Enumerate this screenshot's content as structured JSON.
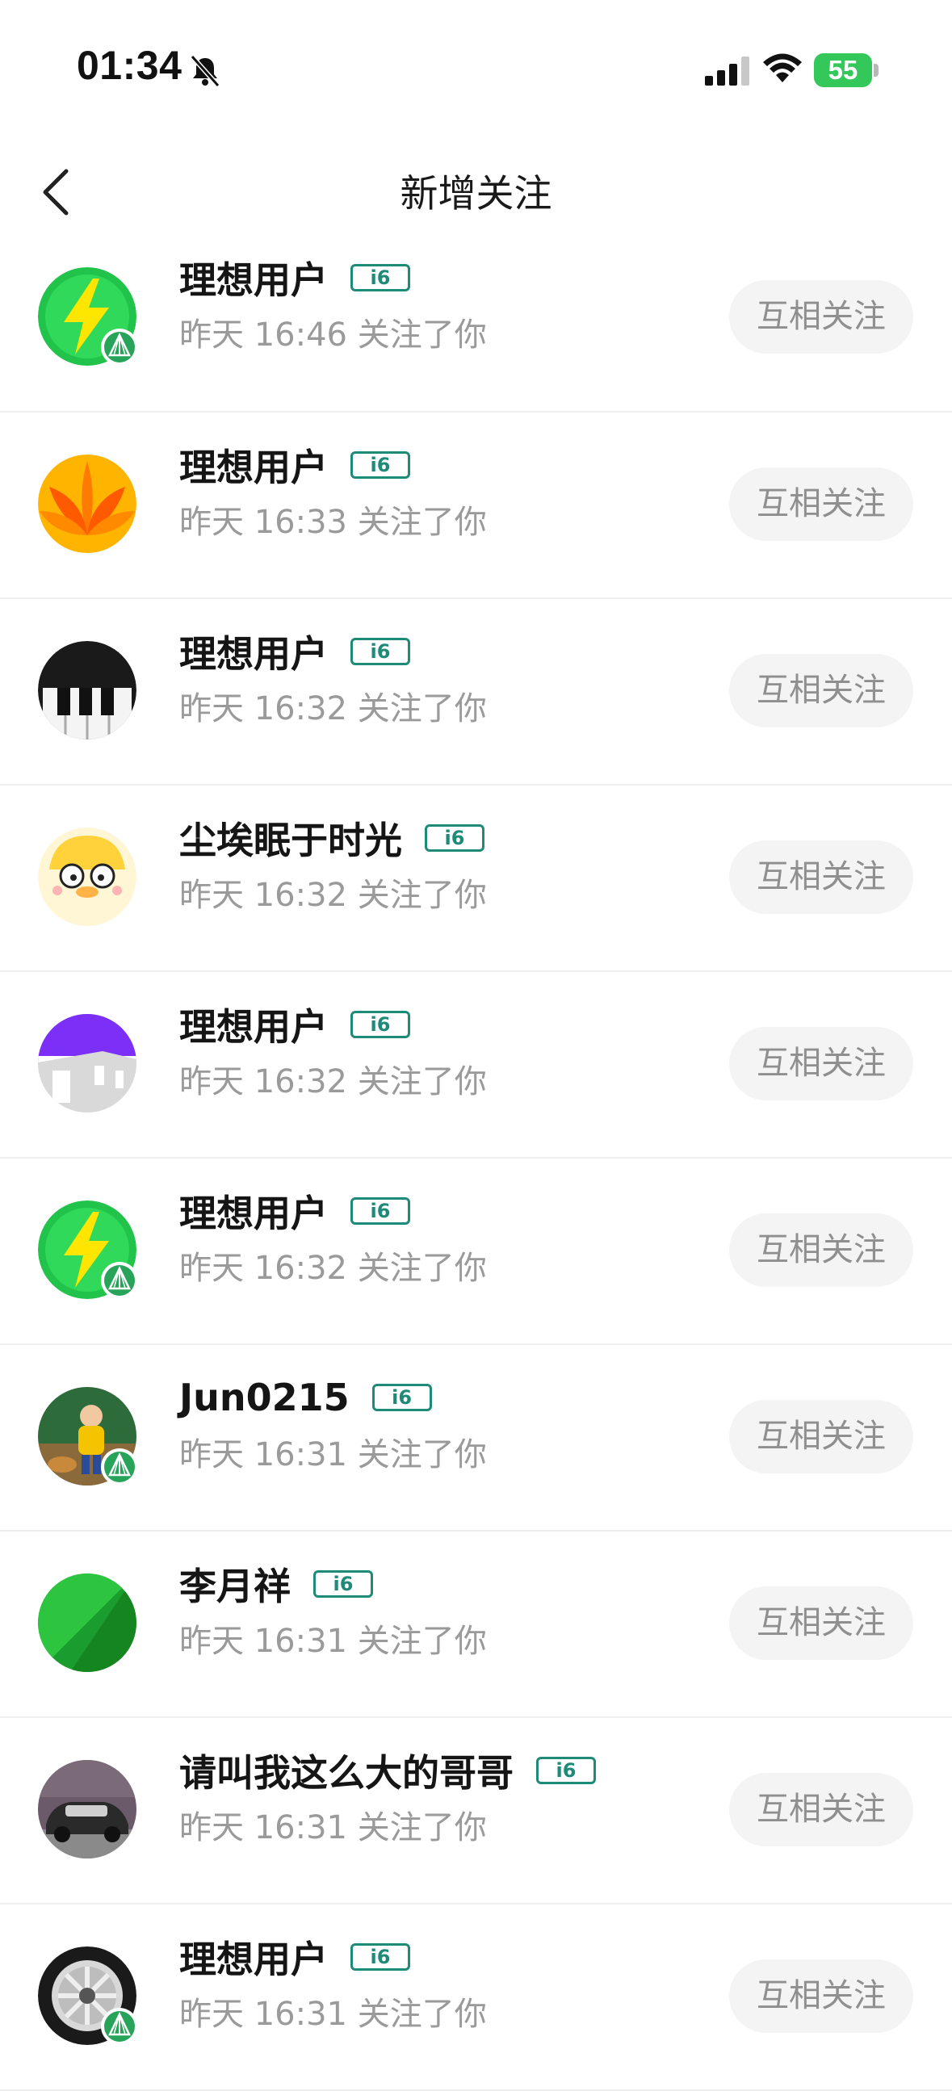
{
  "status_bar": {
    "time": "01:34",
    "battery": "55"
  },
  "header": {
    "title": "新增关注"
  },
  "colors": {
    "tag_border": "#1f8a77",
    "battery": "#34c759",
    "secondary_text": "#9a9a9a",
    "button_bg": "#f4f4f4"
  },
  "followers": [
    {
      "name": "理想用户",
      "tag": "i6",
      "time_text": "昨天 16:46 关注了你",
      "button": "互相关注",
      "avatar": "lightning-green-avatar"
    },
    {
      "name": "理想用户",
      "tag": "i6",
      "time_text": "昨天 16:33 关注了你",
      "button": "互相关注",
      "avatar": "orange-flower-avatar"
    },
    {
      "name": "理想用户",
      "tag": "i6",
      "time_text": "昨天 16:32 关注了你",
      "button": "互相关注",
      "avatar": "piano-keys-avatar"
    },
    {
      "name": "尘埃眠于时光",
      "tag": "i6",
      "time_text": "昨天 16:32 关注了你",
      "button": "互相关注",
      "avatar": "cartoon-duck-avatar"
    },
    {
      "name": "理想用户",
      "tag": "i6",
      "time_text": "昨天 16:32 关注了你",
      "button": "互相关注",
      "avatar": "purple-building-avatar"
    },
    {
      "name": "理想用户",
      "tag": "i6",
      "time_text": "昨天 16:32 关注了你",
      "button": "互相关注",
      "avatar": "lightning-green-avatar"
    },
    {
      "name": "Jun0215",
      "tag": "i6",
      "time_text": "昨天 16:31 关注了你",
      "button": "互相关注",
      "avatar": "child-photo-avatar"
    },
    {
      "name": "李月祥",
      "tag": "i6",
      "time_text": "昨天 16:31 关注了你",
      "button": "互相关注",
      "avatar": "green-geometric-avatar"
    },
    {
      "name": "请叫我这么大的哥哥",
      "tag": "i6",
      "time_text": "昨天 16:31 关注了你",
      "button": "互相关注",
      "avatar": "car-photo-avatar"
    },
    {
      "name": "理想用户",
      "tag": "i6",
      "time_text": "昨天 16:31 关注了你",
      "button": "互相关注",
      "avatar": "wheel-avatar"
    }
  ]
}
